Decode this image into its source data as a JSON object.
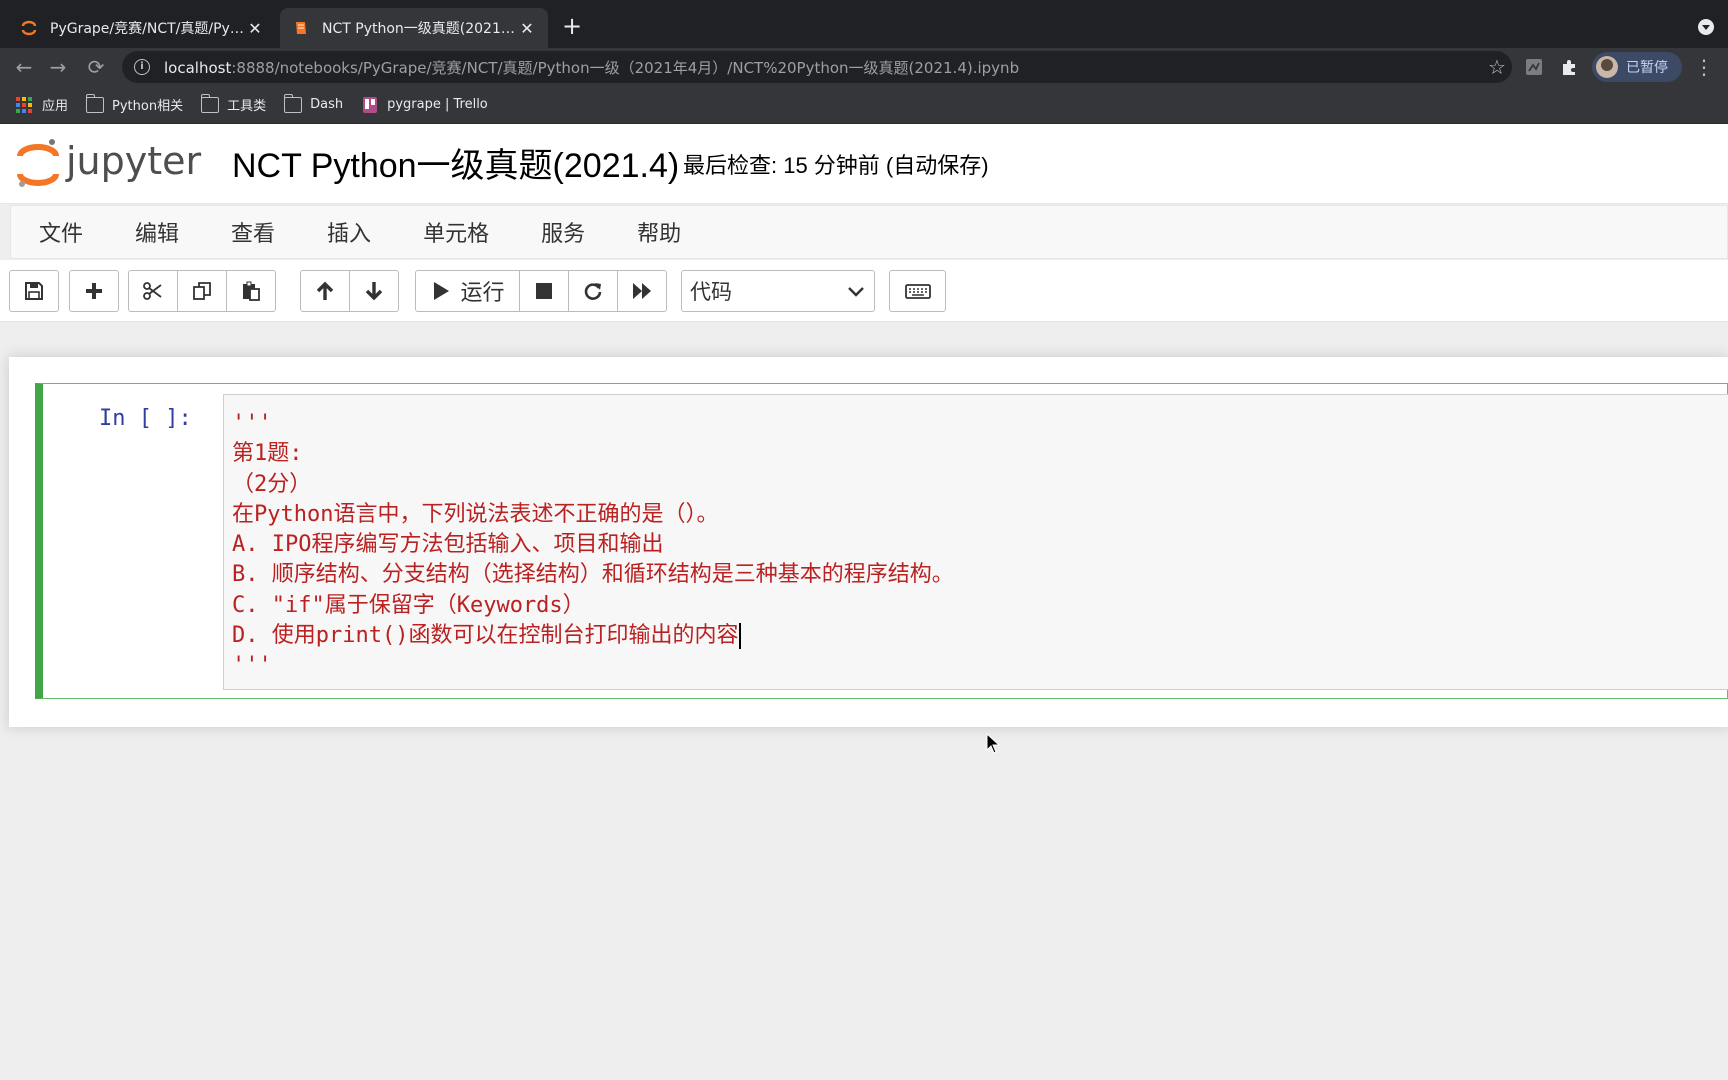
{
  "browser": {
    "tabs": [
      {
        "title": "PyGrape/竞赛/NCT/真题/Python",
        "close": "✕",
        "active": false
      },
      {
        "title": "NCT Python一级真题(2021.4) -",
        "close": "✕",
        "active": true
      }
    ],
    "new_tab": "+",
    "address": {
      "host": "localhost",
      "path": ":8888/notebooks/PyGrape/竞赛/NCT/真题/Python一级（2021年4月）/NCT%20Python一级真题(2021.4).ipynb"
    },
    "profile_label": "已暂停",
    "bookmarks": [
      {
        "label": "应用",
        "icon": "apps-grid-icon"
      },
      {
        "label": "Python相关",
        "icon": "folder-icon"
      },
      {
        "label": "工具类",
        "icon": "folder-icon"
      },
      {
        "label": "Dash",
        "icon": "folder-icon"
      },
      {
        "label": "pygrape | Trello",
        "icon": "trello-icon"
      }
    ]
  },
  "jupyter": {
    "notebook_title": "NCT Python一级真题(2021.4)",
    "checkpoint_status": "最后检查: 15 分钟前  (自动保存)",
    "menu": [
      "文件",
      "编辑",
      "查看",
      "插入",
      "单元格",
      "服务",
      "帮助"
    ],
    "toolbar": {
      "run_label": "运行",
      "cell_type": "代码"
    },
    "cell": {
      "prompt": "In [ ]:",
      "lines": [
        "'''",
        "第1题:",
        "（2分）",
        "在Python语言中，下列说法表述不正确的是（）。",
        "A. IPO程序编写方法包括输入、项目和输出",
        "B. 顺序结构、分支结构（选择结构）和循环结构是三种基本的程序结构。",
        "C. \"if\"属于保留字（Keywords）",
        "D. 使用print()函数可以在控制台打印输出的内容",
        "'''"
      ]
    }
  },
  "colors": {
    "chrome_dark": "#202124",
    "chrome_toolbar": "#35363a",
    "cell_edit_border": "#42a548",
    "string_red": "#ba2121",
    "prompt_blue": "#303f9f",
    "jupyter_orange": "#f37726"
  }
}
